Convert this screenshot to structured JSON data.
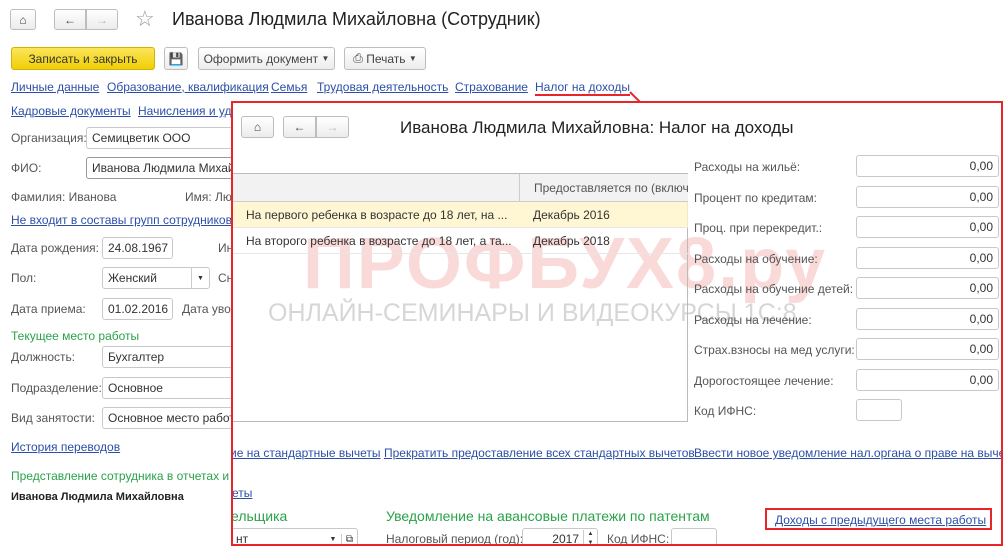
{
  "window": {
    "title": "Иванова Людмила Михайловна (Сотрудник)"
  },
  "toolbar": {
    "save_close": "Записать и закрыть",
    "create_doc": "Оформить документ",
    "print": "Печать"
  },
  "nav_links": [
    "Личные данные",
    "Образование, квалификация",
    "Семья",
    "Трудовая деятельность",
    "Страхование",
    "Налог на доходы"
  ],
  "nav_links2": [
    "Кадровые документы",
    "Начисления и уд"
  ],
  "form": {
    "org_label": "Организация:",
    "org_value": "Семицветик ООО",
    "fio_label": "ФИО:",
    "fio_value": "Иванова Людмила Михай",
    "surname": "Фамилия: Иванова",
    "name": "Имя: Лю",
    "groups_link": "Не входит в составы групп сотрудников.",
    "birth_label": "Дата рождения:",
    "birth_value": "24.08.1967",
    "inn_label": "Ин",
    "sex_label": "Пол:",
    "sex_value": "Женский",
    "snils_label": "Сн",
    "hire_label": "Дата приема:",
    "hire_value": "01.02.2016",
    "fire_label": "Дата уво",
    "current_work": "Текущее место работы",
    "position_label": "Должность:",
    "position_value": "Бухгалтер",
    "dept_label": "Подразделение:",
    "dept_value": "Основное",
    "employment_label": "Вид занятости:",
    "employment_value": "Основное место работы",
    "history_link": "История переводов",
    "representation": "Представление сотрудника в отчетах и д",
    "representation_value": "Иванова Людмила Михайловна"
  },
  "popup": {
    "title": "Иванова Людмила Михайловна: Налог на доходы",
    "table": {
      "columns": [
        "",
        "Предоставляется по (включ"
      ],
      "rows": [
        [
          "На первого ребенка в возрасте до 18 лет, на ...",
          "Декабрь 2016"
        ],
        [
          "На второго ребенка в возрасте до 18 лет, а та...",
          "Декабрь 2018"
        ]
      ]
    },
    "deductions": [
      {
        "label": "Расходы на жильё:",
        "value": "0,00"
      },
      {
        "label": "Процент по кредитам:",
        "value": "0,00"
      },
      {
        "label": "Проц. при перекредит.:",
        "value": "0,00"
      },
      {
        "label": "Расходы на обучение:",
        "value": "0,00"
      },
      {
        "label": "Расходы на обучение детей:",
        "value": "0,00"
      },
      {
        "label": "Расходы на лечение:",
        "value": "0,00"
      },
      {
        "label": "Страх.взносы на мед услуги:",
        "value": "0,00"
      },
      {
        "label": "Дорогостоящее лечение:",
        "value": "0,00"
      }
    ],
    "ifns_label": "Код ИФНС:",
    "ifns_value": "",
    "links": [
      "ие на стандартные вычеты",
      "Прекратить предоставление всех стандартных вычетов",
      "Ввести новое уведомление нал.органа о праве на вычет"
    ],
    "link_ety": "еты",
    "section_left": "ельщика",
    "section_patent": "Уведомление на авансовые платежи по патентам",
    "select_value": "нт",
    "period_label": "Налоговый период (год):",
    "period_value": "2017",
    "ifns2_label": "Код ИФНС:",
    "ifns2_value": "",
    "prev_income_link": "Доходы с предыдущего места работы"
  },
  "watermark": {
    "brand": "ПРОФБУХ8.ру",
    "tagline": "ОНЛАЙН-СЕМИНАРЫ И ВИДЕОКУРСЫ 1С:8"
  },
  "colors": {
    "highlight": "#e8262a",
    "accent_yellow": "#f5d90a",
    "link": "#2b4fa8",
    "green": "#2aa24a"
  }
}
